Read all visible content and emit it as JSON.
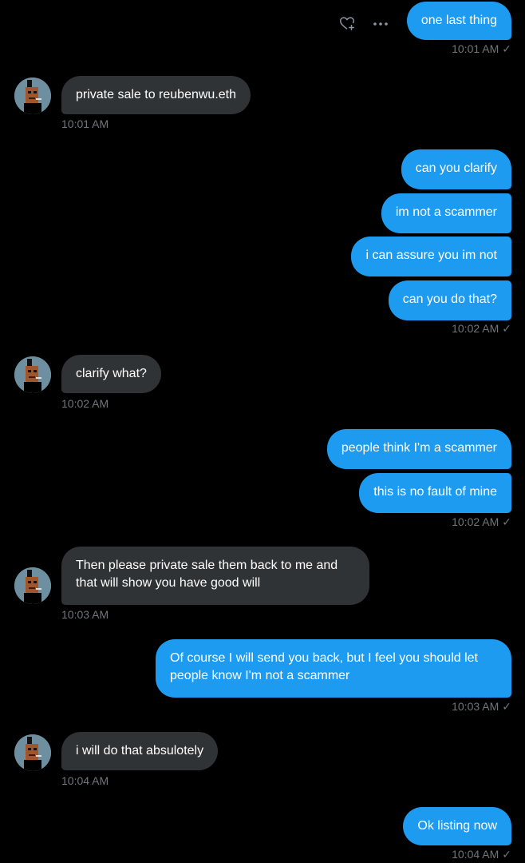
{
  "conversation": {
    "top_sent": {
      "text": "one last thing",
      "time": "10:01 AM",
      "status": "✓"
    },
    "recv_1": {
      "text": "private sale to reubenwu.eth",
      "time": "10:01 AM"
    },
    "sent_group_1": {
      "messages": [
        "can you clarify",
        "im not a scammer",
        "i can assure you im not",
        "can you do that?"
      ],
      "time": "10:02 AM",
      "status": "✓"
    },
    "recv_2": {
      "text": "clarify what?",
      "time": "10:02 AM"
    },
    "sent_group_2": {
      "messages": [
        "people think I'm a scammer",
        "this is no fault of mine"
      ],
      "time": "10:02 AM",
      "status": "✓"
    },
    "recv_3": {
      "text": "Then please private sale them back to me and that will show you have good will",
      "time": "10:03 AM"
    },
    "sent_3": {
      "text": "Of course I will send you back, but I feel you should let people know I'm not a scammer",
      "time": "10:03 AM",
      "status": "✓"
    },
    "recv_4": {
      "text": "i will do that absulotely",
      "time": "10:04 AM"
    },
    "sent_4": {
      "text": "Ok listing now",
      "time": "10:04 AM",
      "status": "✓"
    }
  },
  "icons": {
    "react": "heart-plus-icon",
    "more": "more-horizontal-icon",
    "avatar": "pixel-avatar"
  },
  "colors": {
    "background": "#000000",
    "sent_bubble": "#1d9bf0",
    "received_bubble": "#2f3336",
    "timestamp": "#71767b"
  }
}
